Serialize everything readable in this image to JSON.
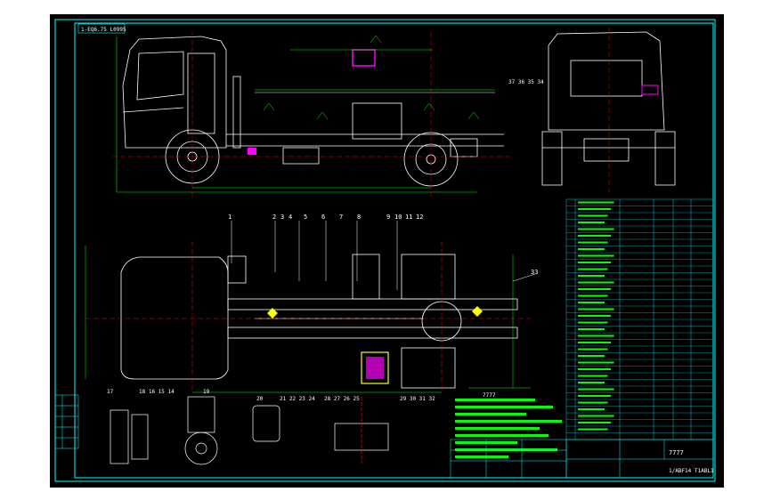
{
  "drawing": {
    "corner_label": "1-EQ6.75 L0995",
    "callouts_top": [
      "1",
      "2",
      "3",
      "4",
      "5",
      "6",
      "7",
      "8",
      "9",
      "10",
      "11",
      "12"
    ],
    "callout_right": "33",
    "rear_view_label": "37 36 35 34",
    "detail_labels": [
      "17",
      "18 16 15 14",
      "19",
      "20",
      "21 22 23 24",
      "28 27 26 25",
      "29 30 31 32"
    ],
    "bottom_dim_label": "7777",
    "title_block": {
      "main_title": "7777",
      "drawing_number": "1/ABF14 T1ABL1"
    }
  },
  "colors": {
    "background": "#000000",
    "frame": "#00ffff",
    "outline": "#ffffff",
    "center_line": "#ff0000",
    "dimension": "#00ff00",
    "highlight": "#ff00ff",
    "accent": "#ffff00"
  }
}
